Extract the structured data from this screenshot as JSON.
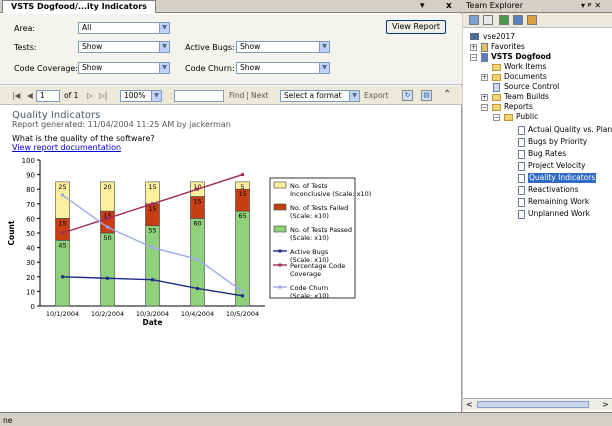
{
  "doc_tab": {
    "title": "VSTS Dogfood/...ity Indicators",
    "pin": "▾",
    "close": "x"
  },
  "params": {
    "area": {
      "label": "Area:",
      "value": "All"
    },
    "tests": {
      "label": "Tests:",
      "value": "Show"
    },
    "active_bugs": {
      "label": "Active Bugs:",
      "value": "Show"
    },
    "code_coverage": {
      "label": "Code Coverage:",
      "value": "Show"
    },
    "code_churn": {
      "label": "Code Churn:",
      "value": "Show"
    },
    "view_report": "View Report"
  },
  "toolbar": {
    "first": "|◀",
    "prev": "◀",
    "page": "1",
    "of": "of 1",
    "next": "▷",
    "last": "▷|",
    "zoom": "100%",
    "find": "Find",
    "sep": "|",
    "next_text": "Next",
    "format": "Select a format",
    "export": "Export"
  },
  "report": {
    "title": "Quality Indicators",
    "generated": "Report generated:  11/04/2004 11:25 AM by jackerman",
    "question": "What is the quality of the software?",
    "doc_link": "View report documentation"
  },
  "chart_data": {
    "type": "bar",
    "categories": [
      "10/1/2004",
      "10/2/2004",
      "10/3/2004",
      "10/4/2004",
      "10/5/2004"
    ],
    "xlabel": "Date",
    "ylabel": "Count",
    "ylim": [
      0,
      100
    ],
    "yticks": [
      0,
      10,
      20,
      30,
      40,
      50,
      60,
      70,
      80,
      90,
      100
    ],
    "stacked_bars": [
      {
        "name": "No. of Tests Passed (Scale: x10)",
        "color": "#8fd07a",
        "values": [
          45,
          50,
          55,
          60,
          65
        ]
      },
      {
        "name": "No. of Tests Failed (Scale: x10)",
        "color": "#c83e14",
        "values": [
          15,
          15,
          15,
          15,
          15
        ]
      },
      {
        "name": "No. of Tests Inconclusive (Scale: x10)",
        "color": "#fff0a0",
        "values": [
          25,
          20,
          15,
          10,
          5
        ]
      }
    ],
    "lines": [
      {
        "name": "Active Bugs (Scale: x10)",
        "color": "#1f2a8c",
        "values": [
          20,
          19,
          18,
          12,
          7
        ]
      },
      {
        "name": "Percentage Code Coverage",
        "color": "#9c2a5c",
        "values": [
          50,
          60,
          70,
          80,
          90
        ]
      },
      {
        "name": "Code Churn (Scale: x10)",
        "color": "#9ea8ee",
        "values": [
          76,
          54,
          40,
          32,
          10
        ]
      }
    ],
    "legend_position": "right",
    "grid": false
  },
  "team_explorer": {
    "title": "Team Explorer",
    "controls": "▾ ᵖ ✕",
    "server": "vse2017",
    "nodes": [
      {
        "label": "Favorites"
      },
      {
        "label": "VSTS Dogfood"
      },
      {
        "label": "Work Items"
      },
      {
        "label": "Documents"
      },
      {
        "label": "Source Control"
      },
      {
        "label": "Team Builds"
      },
      {
        "label": "Reports"
      },
      {
        "label": "Public"
      },
      {
        "label": "Actual Quality vs. Planned"
      },
      {
        "label": "Bugs by Priority"
      },
      {
        "label": "Bug Rates"
      },
      {
        "label": "Project Velocity"
      },
      {
        "label": "Quality Indicators"
      },
      {
        "label": "Reactivations"
      },
      {
        "label": "Remaining Work"
      },
      {
        "label": "Unplanned Work"
      }
    ]
  },
  "status": {
    "text": "ne"
  }
}
